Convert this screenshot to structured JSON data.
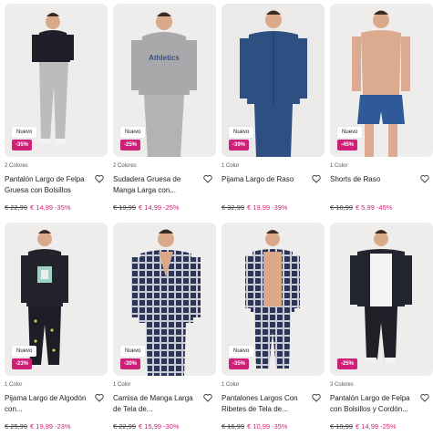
{
  "products": [
    {
      "badge": "Nuevo",
      "discount": "-35%",
      "colors": "2 Colores",
      "title": "Pantalón Largo de Felpa Gruesa con Bolsillos",
      "old_price": "€ 22,99",
      "new_price": "€ 14,99",
      "pct": "-35%",
      "icon": "heart-icon"
    },
    {
      "badge": "Nuevo",
      "discount": "-25%",
      "colors": "2 Colores",
      "title": "Sudadera Gruesa de Manga Larga con...",
      "old_price": "€ 19,99",
      "new_price": "€ 14,99",
      "pct": "-25%",
      "icon": "heart-icon"
    },
    {
      "badge": "Nuevo",
      "discount": "-39%",
      "colors": "1 Color",
      "title": "Pijama Largo de Raso",
      "old_price": "€ 32,99",
      "new_price": "€ 19,99",
      "pct": "-39%",
      "icon": "heart-icon"
    },
    {
      "badge": "Nuevo",
      "discount": "-45%",
      "colors": "1 Color",
      "title": "Shorts de Raso",
      "old_price": "€ 10,99",
      "new_price": "€ 5,99",
      "pct": "-45%",
      "icon": "heart-icon"
    },
    {
      "badge": "Nuevo",
      "discount": "-23%",
      "colors": "1 Color",
      "title": "Pijama Largo de Algodón con...",
      "old_price": "€ 25,99",
      "new_price": "€ 19,99",
      "pct": "-23%",
      "icon": "heart-icon"
    },
    {
      "badge": "Nuevo",
      "discount": "-30%",
      "colors": "1 Color",
      "title": "Camisa de Manga Larga de Tela de...",
      "old_price": "€ 22,99",
      "new_price": "€ 15,99",
      "pct": "-30%",
      "icon": "heart-icon"
    },
    {
      "badge": "Nuevo",
      "discount": "-35%",
      "colors": "1 Color",
      "title": "Pantalones Largos Con Ribetes de Tela de...",
      "old_price": "€ 16,99",
      "new_price": "€ 10,99",
      "pct": "-35%",
      "icon": "heart-icon"
    },
    {
      "badge": "",
      "discount": "-25%",
      "colors": "3 Colores",
      "title": "Pantalón Largo de Felpa con Bolsillos y Cordón...",
      "old_price": "€ 19,99",
      "new_price": "€ 14,99",
      "pct": "-25%",
      "icon": "heart-icon"
    }
  ],
  "colors": {
    "accent": "#d01f79",
    "photo_bg": "#eceae8"
  }
}
